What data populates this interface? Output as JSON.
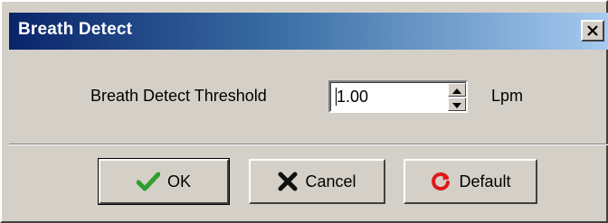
{
  "window": {
    "title": "Breath Detect",
    "close_glyph": "×"
  },
  "form": {
    "threshold_label": "Breath Detect Threshold",
    "threshold_value": "1.00",
    "unit": "Lpm"
  },
  "buttons": {
    "ok_label": "OK",
    "cancel_label": "Cancel",
    "default_label": "Default"
  },
  "icons": {
    "ok": "checkmark-icon",
    "cancel": "x-mark-icon",
    "default": "refresh-icon",
    "close": "close-icon",
    "spin_up": "arrow-up-icon",
    "spin_down": "arrow-down-icon"
  },
  "colors": {
    "title_gradient_start": "#0a246a",
    "title_gradient_end": "#a6caf0",
    "dialog_face": "#d4d0c8",
    "ok_icon": "#2e9e2e",
    "cancel_icon": "#101010",
    "default_icon": "#e01818"
  }
}
